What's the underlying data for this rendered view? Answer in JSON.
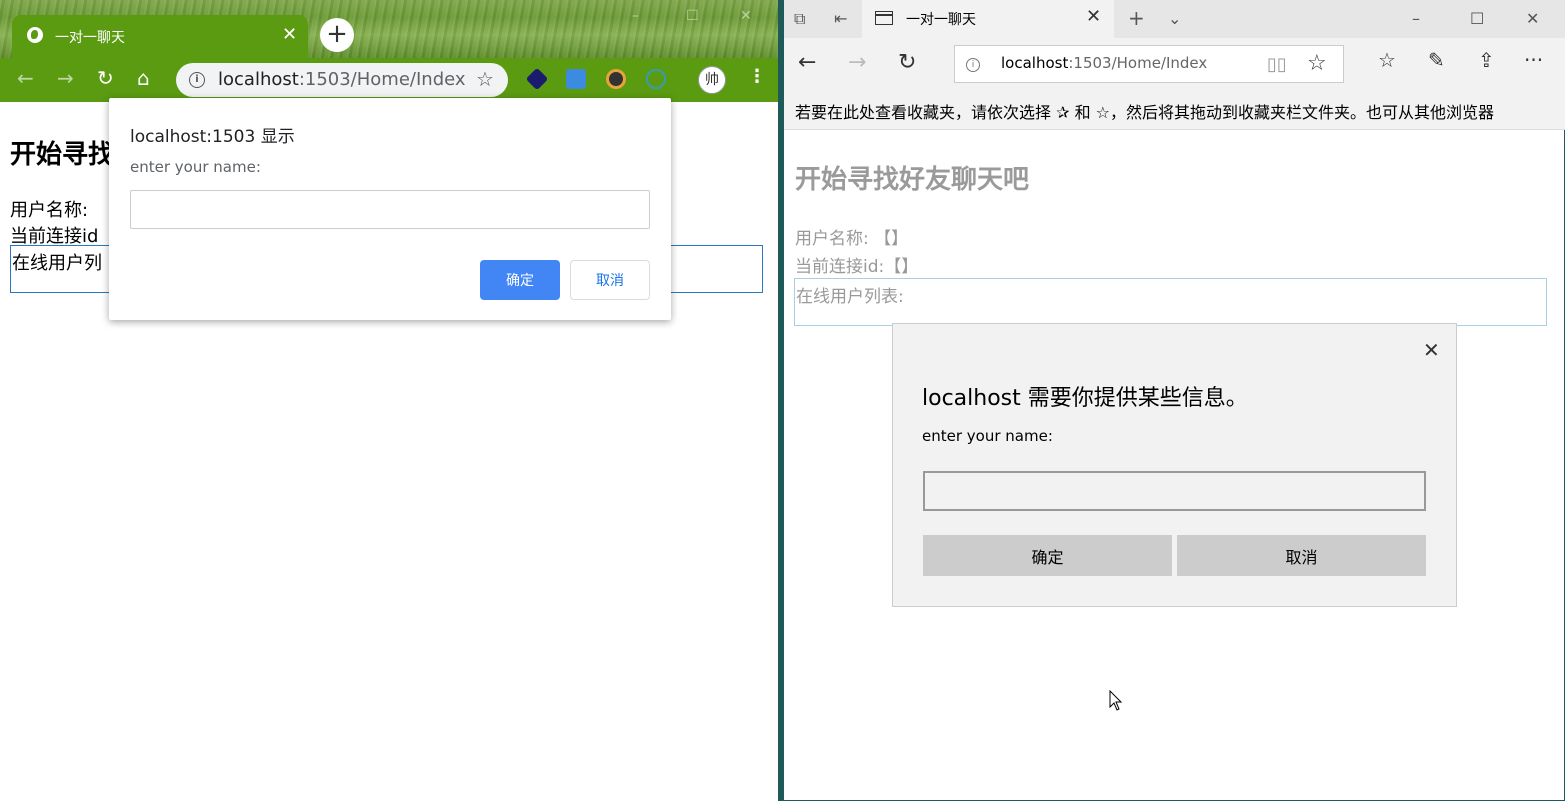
{
  "chrome": {
    "tab": {
      "title": "一对一聊天",
      "close": "✕"
    },
    "new_tab": "+",
    "toolbar": {
      "back": "←",
      "forward": "→",
      "reload": "↻",
      "home": "⌂",
      "menu": "⋮",
      "avatar": "帅"
    },
    "address": {
      "host": "localhost",
      "path": ":1503/Home/Index",
      "star": "☆",
      "info": "i"
    },
    "window_controls": {
      "minimize": "–",
      "maximize": "☐",
      "close": "✕"
    },
    "extensions": [
      "layers-icon",
      "edit-icon",
      "camera-icon",
      "settings-icon"
    ],
    "page": {
      "heading": "开始寻找",
      "username_label": "用户名称:",
      "connection_id_label": "当前连接id",
      "online_list_label": "在线用户列"
    },
    "prompt": {
      "title": "localhost:1503 显示",
      "message": "enter your name:",
      "input_value": "",
      "ok": "确定",
      "cancel": "取消"
    }
  },
  "edge": {
    "tab": {
      "title": "一对一聊天",
      "close": "✕"
    },
    "titlebar": {
      "new_tab": "+",
      "tab_list": "⌄",
      "minimize": "–",
      "maximize": "☐",
      "close": "✕"
    },
    "address": {
      "host": "localhost",
      "path": ":1503/Home/Index",
      "info": "i",
      "reading": "📖",
      "favorite": "☆"
    },
    "toolbar": {
      "back": "←",
      "forward": "→",
      "refresh": "↻",
      "favorites": "☆",
      "notes": "✎",
      "share": "⇪",
      "more": "···"
    },
    "favorites_bar": "若要在此处查看收藏夹，请依次选择 ✰ 和 ☆，然后将其拖动到收藏夹栏文件夹。也可从其他浏览器",
    "page": {
      "heading": "开始寻找好友聊天吧",
      "username_label": "用户名称:",
      "username_value": "【】",
      "connection_id_label": "当前连接id:",
      "connection_id_value": "【】",
      "online_list_label": "在线用户列表:"
    },
    "dialog": {
      "title": "localhost 需要你提供某些信息。",
      "message": "enter your name:",
      "input_value": "",
      "ok": "确定",
      "cancel": "取消",
      "close": "✕"
    }
  },
  "colors": {
    "chrome_toolbar": "#5a9b12",
    "chrome_ok": "#4285f4",
    "edge_chrome": "#f2f2f2",
    "divider": "#1f5a5a"
  }
}
